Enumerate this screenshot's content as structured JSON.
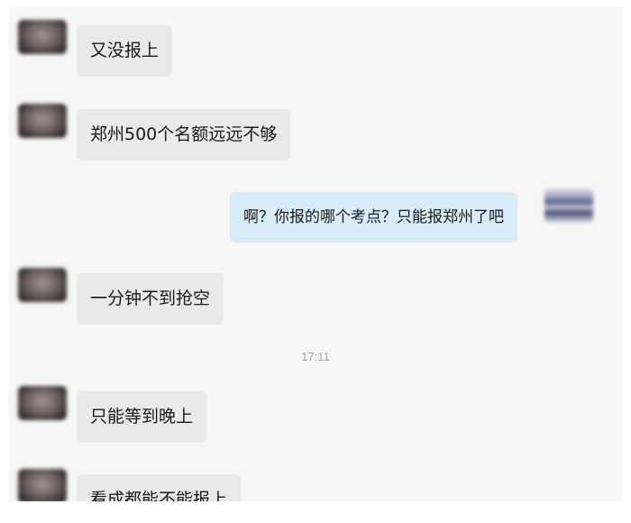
{
  "messages": [
    {
      "text": "又没报上"
    },
    {
      "text": "郑州500个名额远远不够"
    },
    {
      "text": "啊？你报的哪个考点？只能报郑州了吧"
    },
    {
      "text": "一分钟不到抢空"
    },
    {
      "text": "只能等到晚上"
    },
    {
      "text": "看成都能不能报上"
    }
  ],
  "timestamp": "17:11",
  "colors": {
    "incoming_bubble": "#e9e9e9",
    "outgoing_bubble": "#d7ebf8",
    "background": "#f6f6f6"
  }
}
